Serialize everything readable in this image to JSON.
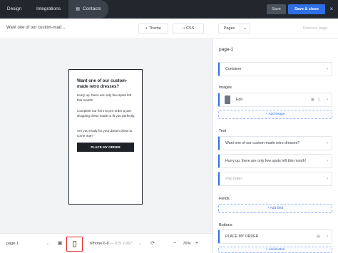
{
  "topbar": {
    "tabs": [
      {
        "label": "Design"
      },
      {
        "label": "Integrations"
      },
      {
        "label": "Contacts"
      }
    ],
    "save_label": "Save",
    "save_close_label": "Save & close",
    "close_icon": "×"
  },
  "subbar": {
    "page_title": "Want one of our custom-mad...",
    "theme_label": "Theme",
    "css_label": "CSS",
    "pages_label": "Pages",
    "remove_page_label": "Remove page"
  },
  "preview": {
    "heading": "Want one of our custom-made retro dresses?",
    "p1": "Hurry up, there are only few spots left this month!",
    "p2": "Complete our form to pre-order a jaw-dropping dress made to fit you perfectly.",
    "p3": "Are you ready for your dream dress to come true?",
    "cta": "PLACE MY ORDER"
  },
  "bottombar": {
    "page_select": "page-1",
    "device_name": "iPhone 6-8",
    "device_dims": "— 375 x 667",
    "zoom_value": "76%",
    "zoom_minus": "−",
    "zoom_plus": "+"
  },
  "panel": {
    "title": "page-1",
    "container_label": "Container",
    "images_label": "Images",
    "image_item_label": "Edit",
    "add_image_label": "+ Add image",
    "text_label": "Text",
    "text_items": [
      "Want one of our custom-made retro dresses?",
      "Hurry up, there are only few spots left this month!",
      "<No note>"
    ],
    "fields_label": "Fields",
    "add_field_label": "+ Add field",
    "buttons_label": "Buttons",
    "button_item_label": "PLACE MY ORDER",
    "add_button_label": "+ Add button"
  },
  "colors": {
    "topbar_bg": "#22272e",
    "accent": "#2f6fe4",
    "highlight": "#e0262c"
  }
}
